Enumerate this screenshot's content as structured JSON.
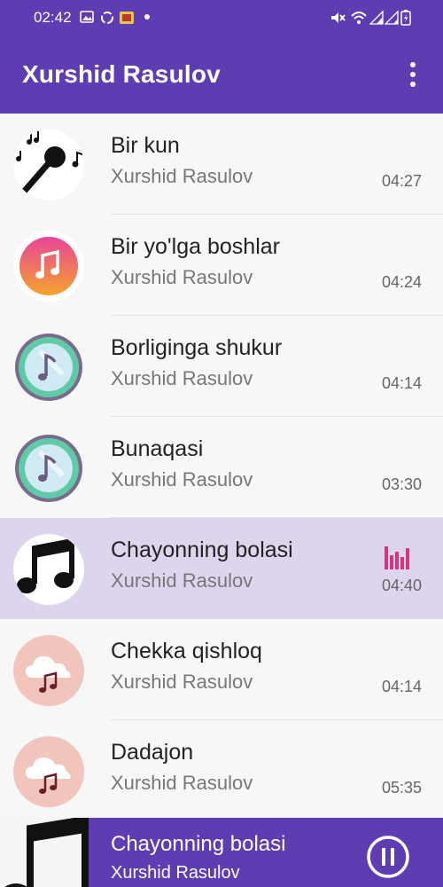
{
  "status_bar": {
    "time": "02:42"
  },
  "app_bar": {
    "title": "Xurshid Rasulov",
    "menu_icon": "more-vert-icon"
  },
  "songs": [
    {
      "title": "Bir kun",
      "artist": "Xurshid Rasulov",
      "duration": "04:27",
      "thumb": "karaoke-mic-icon"
    },
    {
      "title": "Bir yo'lga boshlar",
      "artist": "Xurshid Rasulov",
      "duration": "04:24",
      "thumb": "music-app-icon"
    },
    {
      "title": "Borliginga shukur",
      "artist": "Xurshid Rasulov",
      "duration": "04:14",
      "thumb": "music-disc-icon"
    },
    {
      "title": "Bunaqasi",
      "artist": "Xurshid Rasulov",
      "duration": "03:30",
      "thumb": "music-disc-icon"
    },
    {
      "title": "Chayonning bolasi",
      "artist": "Xurshid Rasulov",
      "duration": "04:40",
      "thumb": "music-notes-icon",
      "playing": true
    },
    {
      "title": "Chekka qishloq",
      "artist": "Xurshid Rasulov",
      "duration": "04:14",
      "thumb": "cloud-music-icon"
    },
    {
      "title": "Dadajon",
      "artist": "Xurshid Rasulov",
      "duration": "05:35",
      "thumb": "cloud-music-icon"
    }
  ],
  "now_playing": {
    "title": "Chayonning bolasi",
    "artist": "Xurshid Rasulov",
    "control": "pause-icon"
  },
  "colors": {
    "primary": "#5e3db3",
    "active_row": "#ddd5ee",
    "equalizer": "#d63384"
  }
}
